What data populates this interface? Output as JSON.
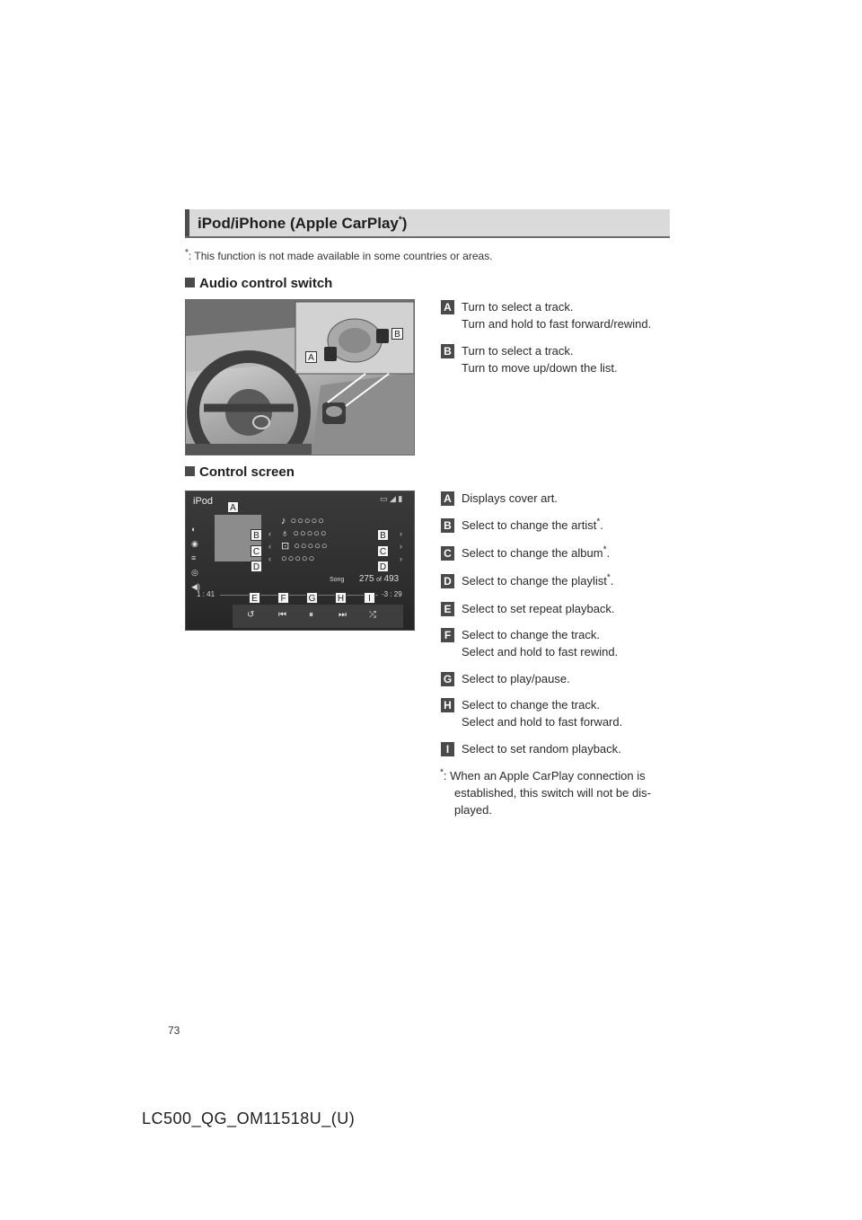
{
  "section": {
    "title": "iPod/iPhone (Apple CarPlay",
    "title_mark": "*",
    "title_end": ")"
  },
  "footnote_top": {
    "mark": "*",
    "text": ":   This function is not made available in some countries or areas."
  },
  "audio_switch": {
    "heading": "Audio control switch",
    "callouts": [
      "A",
      "B"
    ],
    "items": [
      {
        "letter": "A",
        "lines": [
          "Turn to select a track.",
          "Turn and hold to fast forward/rewind."
        ]
      },
      {
        "letter": "B",
        "lines": [
          "Turn to select a track.",
          "Turn to move up/down the list."
        ]
      }
    ]
  },
  "control_screen": {
    "heading": "Control screen",
    "screen": {
      "app_label": "iPod",
      "rows": [
        "♪ ○○○○○",
        "♁ ○○○○○",
        "⊡ ○○○○○",
        "○○○○○"
      ],
      "song_label": "Song",
      "track_current": "275",
      "track_of": "of",
      "track_total": "493",
      "time_elapsed": "1 : 41",
      "time_remaining": "-3 : 29",
      "callouts": [
        "A",
        "B",
        "C",
        "D",
        "E",
        "F",
        "G",
        "H",
        "I"
      ]
    },
    "items": [
      {
        "letter": "A",
        "lines": [
          "Displays cover art."
        ]
      },
      {
        "letter": "B",
        "lines": [
          "Select to change the artist"
        ],
        "mark": "*",
        "end": "."
      },
      {
        "letter": "C",
        "lines": [
          "Select to change the album"
        ],
        "mark": "*",
        "end": "."
      },
      {
        "letter": "D",
        "lines": [
          "Select to change the playlist"
        ],
        "mark": "*",
        "end": "."
      },
      {
        "letter": "E",
        "lines": [
          "Select to set repeat playback."
        ]
      },
      {
        "letter": "F",
        "lines": [
          "Select to change the track.",
          "Select and hold to fast rewind."
        ]
      },
      {
        "letter": "G",
        "lines": [
          "Select to play/pause."
        ]
      },
      {
        "letter": "H",
        "lines": [
          "Select to change the track.",
          "Select and hold to fast forward."
        ]
      },
      {
        "letter": "I",
        "lines": [
          "Select to set random playback."
        ]
      }
    ],
    "footnote": {
      "mark": "*",
      "lines": [
        ":  When an Apple CarPlay connection is",
        "established, this switch will not be dis-",
        "played."
      ]
    }
  },
  "page_number": "73",
  "footer_code": "LC500_QG_OM11518U_(U)",
  "colors": {
    "header_bg": "#dadada",
    "badge_bg": "#4a4a4a",
    "text": "#2a2a2a"
  }
}
